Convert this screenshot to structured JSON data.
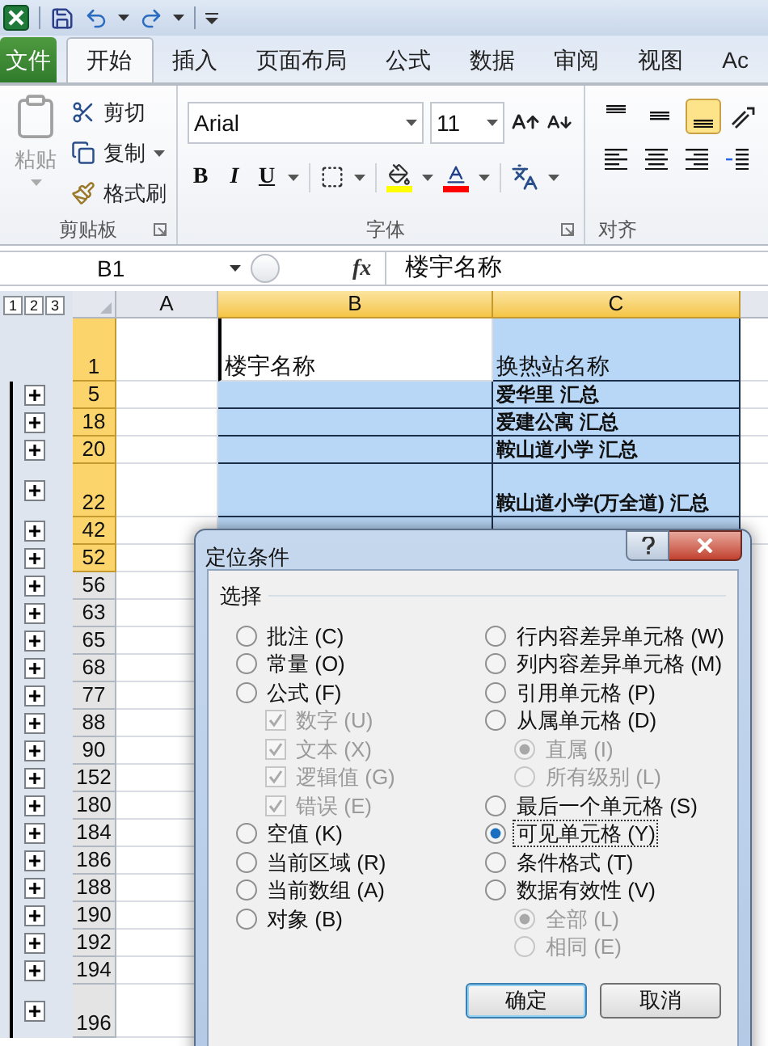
{
  "tabs": [
    {
      "label": "文件",
      "kind": "file",
      "selected": false
    },
    {
      "label": "开始",
      "kind": "tab",
      "selected": true
    },
    {
      "label": "插入",
      "kind": "tab",
      "selected": false
    },
    {
      "label": "页面布局",
      "kind": "tab",
      "selected": false
    },
    {
      "label": "公式",
      "kind": "tab",
      "selected": false
    },
    {
      "label": "数据",
      "kind": "tab",
      "selected": false
    },
    {
      "label": "审阅",
      "kind": "tab",
      "selected": false
    },
    {
      "label": "视图",
      "kind": "tab",
      "selected": false
    },
    {
      "label": "Ac",
      "kind": "tab",
      "selected": false
    }
  ],
  "clipboard": {
    "paste": "粘贴",
    "cut": "剪切",
    "copy": "复制",
    "format_painter": "格式刷",
    "title": "剪贴板"
  },
  "font": {
    "name": "Arial",
    "size": "11",
    "bold": "B",
    "italic": "I",
    "underline": "U",
    "title": "字体"
  },
  "alignment": {
    "vertical": [
      {
        "kind": "top",
        "selected": false
      },
      {
        "kind": "middle",
        "selected": false
      },
      {
        "kind": "bottom",
        "selected": true
      }
    ],
    "title": "对齐"
  },
  "formula_bar": {
    "name_box": "B1",
    "fx": "fx",
    "value": "楼宇名称"
  },
  "outline_levels": [
    "1",
    "2",
    "3"
  ],
  "columns": [
    {
      "label": "A",
      "selected": false
    },
    {
      "label": "B",
      "selected": true
    },
    {
      "label": "C",
      "selected": true
    }
  ],
  "rows": [
    {
      "header": "1",
      "kind": "header",
      "selected": true,
      "b": "楼宇名称",
      "c": "换热站名称"
    },
    {
      "header": "5",
      "kind": "normal",
      "selected": true,
      "collapsed": true,
      "c": "爱华里 汇总"
    },
    {
      "header": "18",
      "kind": "normal",
      "selected": true,
      "collapsed": true,
      "c": "爱建公寓 汇总"
    },
    {
      "header": "20",
      "kind": "normal",
      "selected": true,
      "collapsed": true,
      "c": "鞍山道小学 汇总"
    },
    {
      "header": "22",
      "kind": "tall",
      "selected": true,
      "collapsed": true,
      "c": "鞍山道小学(万全道) 汇总"
    },
    {
      "header": "42",
      "kind": "normal",
      "selected": true,
      "collapsed": true
    },
    {
      "header": "52",
      "kind": "normal",
      "selected": true,
      "collapsed": true
    },
    {
      "header": "56",
      "kind": "normal",
      "selected": false,
      "collapsed": true
    },
    {
      "header": "63",
      "kind": "normal",
      "selected": false,
      "collapsed": true
    },
    {
      "header": "65",
      "kind": "normal",
      "selected": false,
      "collapsed": true
    },
    {
      "header": "68",
      "kind": "normal",
      "selected": false,
      "collapsed": true
    },
    {
      "header": "77",
      "kind": "normal",
      "selected": false,
      "collapsed": true
    },
    {
      "header": "88",
      "kind": "normal",
      "selected": false,
      "collapsed": true
    },
    {
      "header": "90",
      "kind": "normal",
      "selected": false,
      "collapsed": true
    },
    {
      "header": "152",
      "kind": "normal",
      "selected": false,
      "collapsed": true
    },
    {
      "header": "180",
      "kind": "normal",
      "selected": false,
      "collapsed": true
    },
    {
      "header": "184",
      "kind": "normal",
      "selected": false,
      "collapsed": true
    },
    {
      "header": "186",
      "kind": "normal",
      "selected": false,
      "collapsed": true
    },
    {
      "header": "188",
      "kind": "normal",
      "selected": false,
      "collapsed": true
    },
    {
      "header": "190",
      "kind": "normal",
      "selected": false,
      "collapsed": true
    },
    {
      "header": "192",
      "kind": "normal",
      "selected": false,
      "collapsed": true
    },
    {
      "header": "194",
      "kind": "normal",
      "selected": false,
      "collapsed": true
    },
    {
      "header": "196",
      "kind": "tall",
      "selected": false,
      "collapsed": true
    }
  ],
  "dialog": {
    "title": "定位条件",
    "group": "选择",
    "left": [
      {
        "label": "批注 (C)",
        "kind": "radio",
        "selected": false,
        "disabled": false
      },
      {
        "label": "常量 (O)",
        "kind": "radio",
        "selected": false,
        "disabled": false
      },
      {
        "label": "公式 (F)",
        "kind": "radio",
        "selected": false,
        "disabled": false,
        "children": [
          {
            "label": "数字 (U)",
            "kind": "checkbox",
            "checked": true,
            "disabled": true
          },
          {
            "label": "文本 (X)",
            "kind": "checkbox",
            "checked": true,
            "disabled": true
          },
          {
            "label": "逻辑值 (G)",
            "kind": "checkbox",
            "checked": true,
            "disabled": true
          },
          {
            "label": "错误 (E)",
            "kind": "checkbox",
            "checked": true,
            "disabled": true
          }
        ]
      },
      {
        "label": "空值 (K)",
        "kind": "radio",
        "selected": false,
        "disabled": false
      },
      {
        "label": "当前区域 (R)",
        "kind": "radio",
        "selected": false,
        "disabled": false
      },
      {
        "label": "当前数组 (A)",
        "kind": "radio",
        "selected": false,
        "disabled": false
      },
      {
        "label": "对象 (B)",
        "kind": "radio",
        "selected": false,
        "disabled": false
      }
    ],
    "right": [
      {
        "label": "行内容差异单元格 (W)",
        "kind": "radio",
        "selected": false,
        "disabled": false
      },
      {
        "label": "列内容差异单元格 (M)",
        "kind": "radio",
        "selected": false,
        "disabled": false
      },
      {
        "label": "引用单元格 (P)",
        "kind": "radio",
        "selected": false,
        "disabled": false
      },
      {
        "label": "从属单元格 (D)",
        "kind": "radio",
        "selected": false,
        "disabled": false,
        "children": [
          {
            "label": "直属 (I)",
            "kind": "radio",
            "selected": true,
            "disabled": true
          },
          {
            "label": "所有级别 (L)",
            "kind": "radio",
            "selected": false,
            "disabled": true
          }
        ]
      },
      {
        "label": "最后一个单元格 (S)",
        "kind": "radio",
        "selected": false,
        "disabled": false
      },
      {
        "label": "可见单元格 (Y)",
        "kind": "radio",
        "selected": true,
        "disabled": false
      },
      {
        "label": "条件格式 (T)",
        "kind": "radio",
        "selected": false,
        "disabled": false
      },
      {
        "label": "数据有效性 (V)",
        "kind": "radio",
        "selected": false,
        "disabled": false,
        "children": [
          {
            "label": "全部 (L)",
            "kind": "radio",
            "selected": true,
            "disabled": true
          },
          {
            "label": "相同 (E)",
            "kind": "radio",
            "selected": false,
            "disabled": true
          }
        ]
      }
    ],
    "buttons": [
      {
        "label": "确定",
        "default": true
      },
      {
        "label": "取消",
        "default": false
      }
    ]
  }
}
